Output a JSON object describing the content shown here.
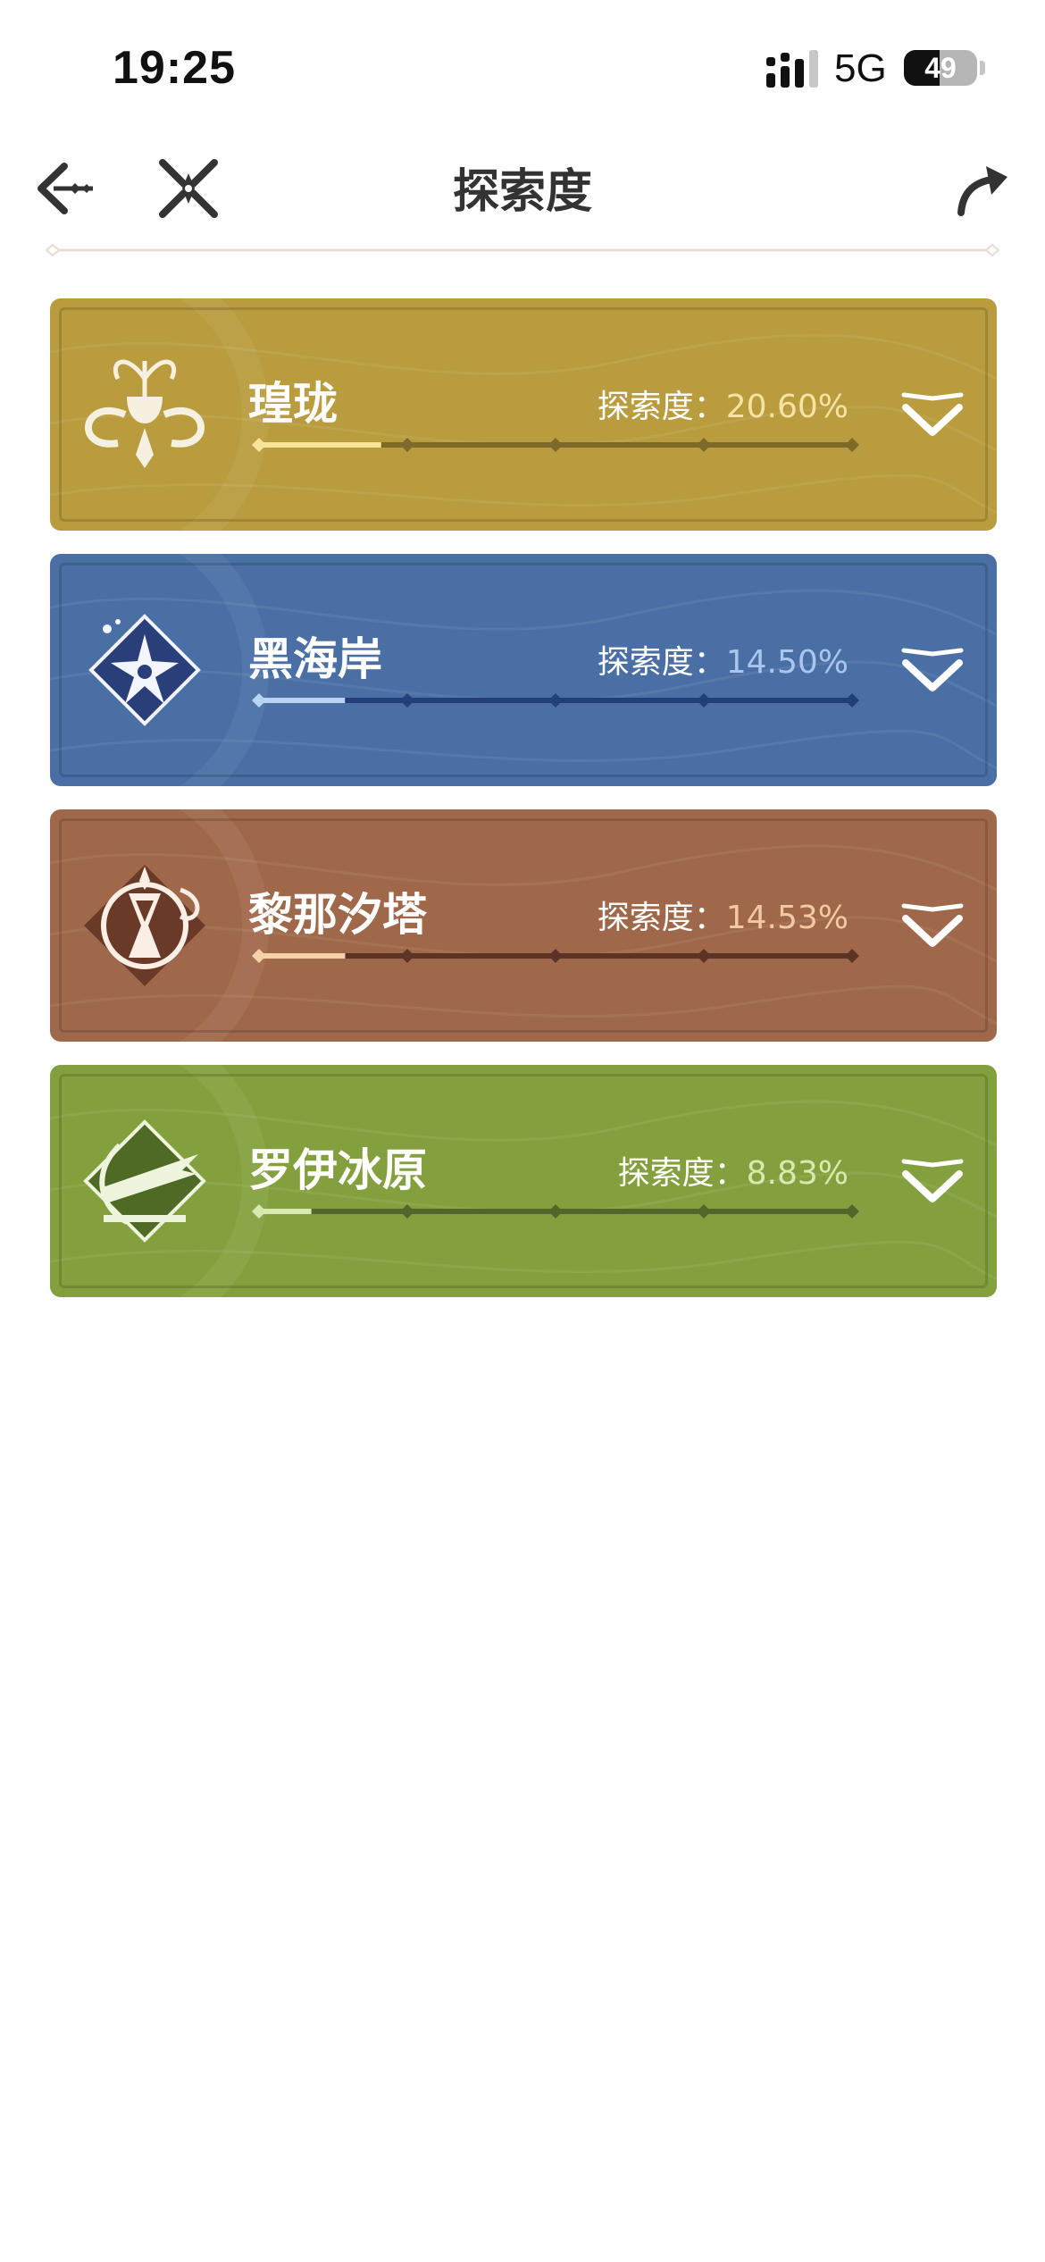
{
  "status_bar": {
    "time": "19:25",
    "network": "5G",
    "battery_text": "49",
    "battery_level": 0.49,
    "icons": [
      "signal-icon",
      "battery-icon"
    ]
  },
  "header": {
    "title": "探索度",
    "icons": [
      "back-arrow-icon",
      "crossed-swords-logo-icon",
      "share-arrow-icon"
    ]
  },
  "regions": [
    {
      "name": "瑝珑",
      "label": "探索度：",
      "value": "20.60%",
      "progress": 0.206,
      "colors": {
        "bg": "#b89c3e",
        "track": "#7d6a2b",
        "fill": "#f7e39a",
        "accent": "#f6e3a3"
      },
      "emblem_icon": "dragon-emblem-icon"
    },
    {
      "name": "黑海岸",
      "label": "探索度：",
      "value": "14.50%",
      "progress": 0.145,
      "colors": {
        "bg": "#4a6fa5",
        "track": "#223f7a",
        "fill": "#b9d3f3",
        "accent": "#aac6ee"
      },
      "emblem_icon": "star-flower-emblem-icon"
    },
    {
      "name": "黎那汐塔",
      "label": "探索度：",
      "value": "14.53%",
      "progress": 0.1453,
      "colors": {
        "bg": "#a0684a",
        "track": "#5c3426",
        "fill": "#f6d2a8",
        "accent": "#f2c9a2"
      },
      "emblem_icon": "hourglass-emblem-icon"
    },
    {
      "name": "罗伊冰原",
      "label": "探索度：",
      "value": "8.83%",
      "progress": 0.0883,
      "colors": {
        "bg": "#84a03e",
        "track": "#51662a",
        "fill": "#d9eab1",
        "accent": "#d7ebb0"
      },
      "emblem_icon": "arrow-shield-emblem-icon"
    }
  ]
}
